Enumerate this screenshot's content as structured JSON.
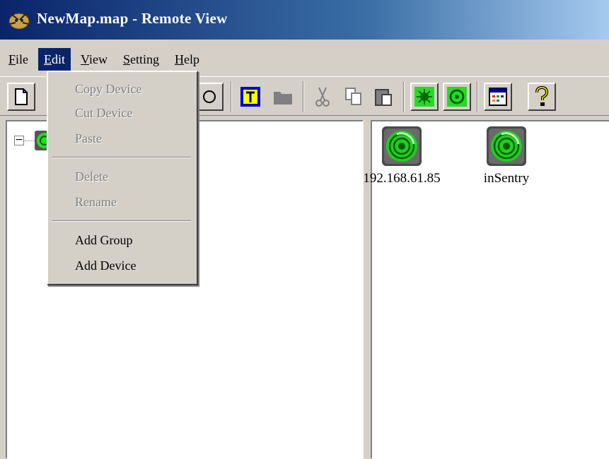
{
  "window": {
    "title": "NewMap.map - Remote View"
  },
  "menubar": {
    "items": [
      {
        "label": "File",
        "accel": "F"
      },
      {
        "label": "Edit",
        "accel": "E",
        "active": true
      },
      {
        "label": "View",
        "accel": "V"
      },
      {
        "label": "Setting",
        "accel": "S"
      },
      {
        "label": "Help",
        "accel": "H"
      }
    ]
  },
  "edit_menu": {
    "items": [
      {
        "label": "Copy Device",
        "enabled": false
      },
      {
        "label": "Cut Device",
        "enabled": false
      },
      {
        "label": "Paste",
        "enabled": false
      },
      {
        "label": "Delete",
        "enabled": false
      },
      {
        "label": "Rename",
        "enabled": false
      },
      {
        "label": "Add Group",
        "enabled": true
      },
      {
        "label": "Add Device",
        "enabled": true
      }
    ]
  },
  "toolbar": {
    "buttons": [
      "new-icon",
      "text-icon",
      "folder-icon",
      "cut-icon",
      "copy-icon",
      "paste-icon",
      "bug-scan-icon",
      "device-scan-icon",
      "calendar-icon",
      "help-icon"
    ]
  },
  "tree": {
    "expander": "⊟"
  },
  "devices": [
    {
      "label": "192.168.61.85",
      "icon": "device-icon"
    },
    {
      "label": "inSentry",
      "icon": "device-icon"
    }
  ],
  "colors": {
    "title_start": "#0a246a",
    "title_end": "#a6caf0",
    "device_green": "#22dd22",
    "menu_highlight": "#0a246a"
  }
}
